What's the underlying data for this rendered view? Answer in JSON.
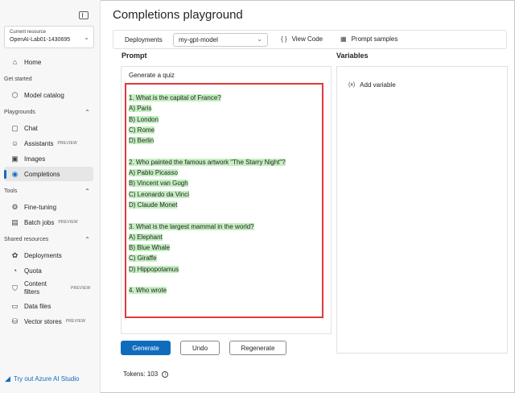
{
  "sidebar": {
    "resource_label": "Current resource",
    "resource_value": "OpenAI-Lab01-1430695",
    "items_top": [
      {
        "label": "Home",
        "icon": "home-icon"
      }
    ],
    "get_started": {
      "label": "Get started",
      "items": [
        {
          "label": "Model catalog",
          "icon": "cube-icon"
        }
      ]
    },
    "playgrounds": {
      "label": "Playgrounds",
      "items": [
        {
          "label": "Chat",
          "icon": "chat-icon",
          "badge": ""
        },
        {
          "label": "Assistants",
          "icon": "assistant-icon",
          "badge": "PREVIEW"
        },
        {
          "label": "Images",
          "icon": "image-icon",
          "badge": ""
        },
        {
          "label": "Completions",
          "icon": "completions-icon",
          "badge": "",
          "active": true
        }
      ]
    },
    "tools": {
      "label": "Tools",
      "items": [
        {
          "label": "Fine-tuning",
          "icon": "tuning-icon",
          "badge": ""
        },
        {
          "label": "Batch jobs",
          "icon": "batch-icon",
          "badge": "PREVIEW"
        }
      ]
    },
    "shared": {
      "label": "Shared resources",
      "items": [
        {
          "label": "Deployments",
          "icon": "deployments-icon",
          "badge": ""
        },
        {
          "label": "Quota",
          "icon": "quota-icon",
          "badge": ""
        },
        {
          "label": "Content filters",
          "icon": "shield-icon",
          "badge": "PREVIEW"
        },
        {
          "label": "Data files",
          "icon": "file-icon",
          "badge": ""
        },
        {
          "label": "Vector stores",
          "icon": "database-icon",
          "badge": "PREVIEW"
        }
      ]
    },
    "try_link": "Try out Azure AI Studio"
  },
  "main": {
    "title": "Completions playground",
    "toolbar": {
      "deployments_label": "Deployments",
      "deployment_value": "my-gpt-model",
      "view_code": "View Code",
      "prompt_samples": "Prompt samples"
    },
    "prompt_heading": "Prompt",
    "variables_heading": "Variables",
    "prompt_intro": "Generate a quiz",
    "quiz_lines": [
      "1. What is the capital of France?",
      "A) Paris",
      "B) London",
      "C) Rome",
      "D) Berlin",
      "",
      "2. Who painted the famous artwork \"The Starry Night\"?",
      "A) Pablo Picasso",
      "B) Vincent van Gogh",
      "C) Leonardo da Vinci",
      "D) Claude Monet",
      "",
      "3. What is the largest mammal in the world?",
      "A) Elephant",
      "B) Blue Whale",
      "C) Giraffe",
      "D) Hippopotamus",
      "",
      "4. Who wrote"
    ],
    "add_variable": "Add variable",
    "buttons": {
      "generate": "Generate",
      "undo": "Undo",
      "regenerate": "Regenerate"
    },
    "tokens_label": "Tokens:",
    "tokens_value": "103"
  },
  "colors": {
    "accent": "#0f6cbd",
    "highlight": "#c4f0c0",
    "annotation_border": "#e03a3a"
  }
}
